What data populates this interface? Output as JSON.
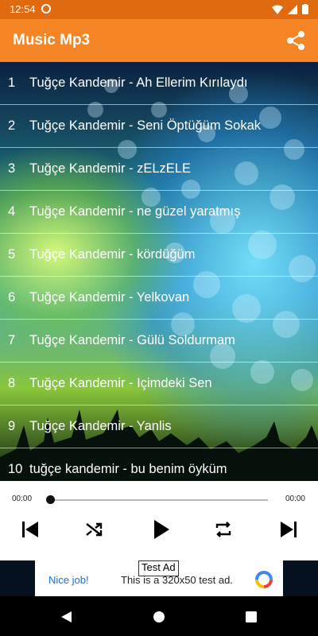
{
  "status_bar": {
    "time": "12:54"
  },
  "app_bar": {
    "title": "Music Mp3"
  },
  "songs": [
    {
      "num": "1",
      "title": "Tuğçe Kandemir - Ah Ellerim Kırılaydı"
    },
    {
      "num": "2",
      "title": "Tuğçe Kandemir - Seni Öptüğüm Sokak"
    },
    {
      "num": "3",
      "title": "Tuğçe Kandemir - zELzELE"
    },
    {
      "num": "4",
      "title": "Tuğçe Kandemir - ne güzel yaratmış"
    },
    {
      "num": "5",
      "title": "Tuğçe Kandemir - kördüğüm"
    },
    {
      "num": "6",
      "title": "Tuğçe Kandemir - Yelkovan"
    },
    {
      "num": "7",
      "title": "Tuğçe Kandemir - Gülü Soldurmam"
    },
    {
      "num": "8",
      "title": "Tuğçe Kandemir - Içimdeki Sen"
    },
    {
      "num": "9",
      "title": "Tuğçe Kandemir - Yanlis"
    },
    {
      "num": "10",
      "title": "tuğçe kandemir - bu benim öyküm"
    }
  ],
  "player": {
    "current_time": "00:00",
    "total_time": "00:00",
    "progress": 0,
    "controls": [
      "skip-previous-icon",
      "shuffle-icon",
      "play-icon",
      "repeat-icon",
      "skip-next-icon"
    ]
  },
  "ad": {
    "label": "Test Ad",
    "nice": "Nice job!",
    "text": "This is a 320x50 test ad."
  },
  "colors": {
    "status_bar": "#e06a10",
    "app_bar": "#f58524",
    "ad_link": "#1a6fd4"
  }
}
